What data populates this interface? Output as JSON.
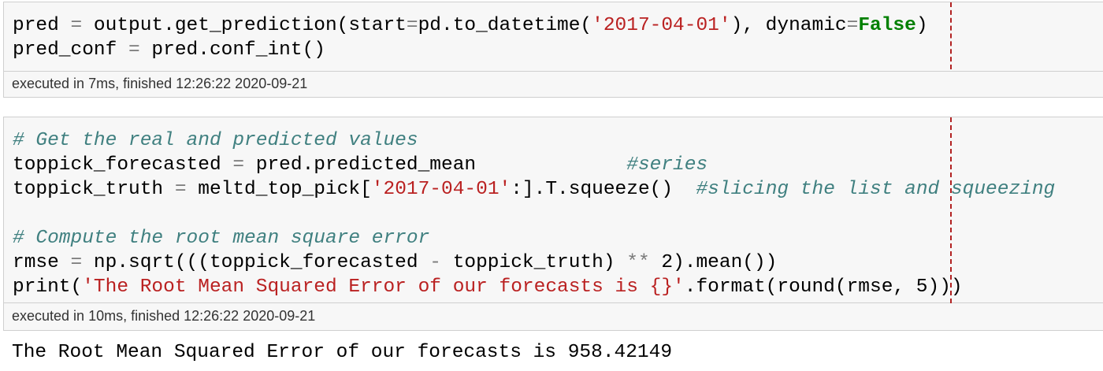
{
  "cell1": {
    "line1": {
      "a": "pred ",
      "eq1": "=",
      "b": " output.get_prediction(start",
      "eq2": "=",
      "c": "pd.to_datetime(",
      "str": "'2017-04-01'",
      "d": "), dynamic",
      "eq3": "=",
      "kw": "False",
      "e": ")"
    },
    "line2": {
      "a": "pred_conf ",
      "eq": "=",
      "b": " pred.conf_int()"
    },
    "exec": "executed in 7ms, finished 12:26:22 2020-09-21"
  },
  "cell2": {
    "line1": {
      "comment": "# Get the real and predicted values"
    },
    "line2": {
      "a": "toppick_forecasted ",
      "eq": "=",
      "b": " pred.predicted_mean             ",
      "comment": "#series"
    },
    "line3": {
      "a": "toppick_truth ",
      "eq": "=",
      "b": " meltd_top_pick[",
      "str": "'2017-04-01'",
      "c": ":].T.squeeze()  ",
      "comment": "#slicing the list and squeezing"
    },
    "line4": {
      "comment": "# Compute the root mean square error"
    },
    "line5": {
      "a": "rmse ",
      "eq": "=",
      "b": " np.sqrt(((toppick_forecasted ",
      "minus": "-",
      "c": " toppick_truth) ",
      "pow": "**",
      "d": " 2).mean())"
    },
    "line6": {
      "a": "print(",
      "str": "'The Root Mean Squared Error of our forecasts is {}'",
      "b": ".format(round(rmse, 5)))"
    },
    "exec": "executed in 10ms, finished 12:26:22 2020-09-21"
  },
  "output": "The Root Mean Squared Error of our forecasts is 958.42149",
  "colors": {
    "string": "#ba2121",
    "keyword": "#008000",
    "comment": "#408080",
    "operator": "#7a7a7a",
    "ruler": "#b22222",
    "cell_background": "#f7f7f7",
    "border": "#cfcfcf"
  }
}
